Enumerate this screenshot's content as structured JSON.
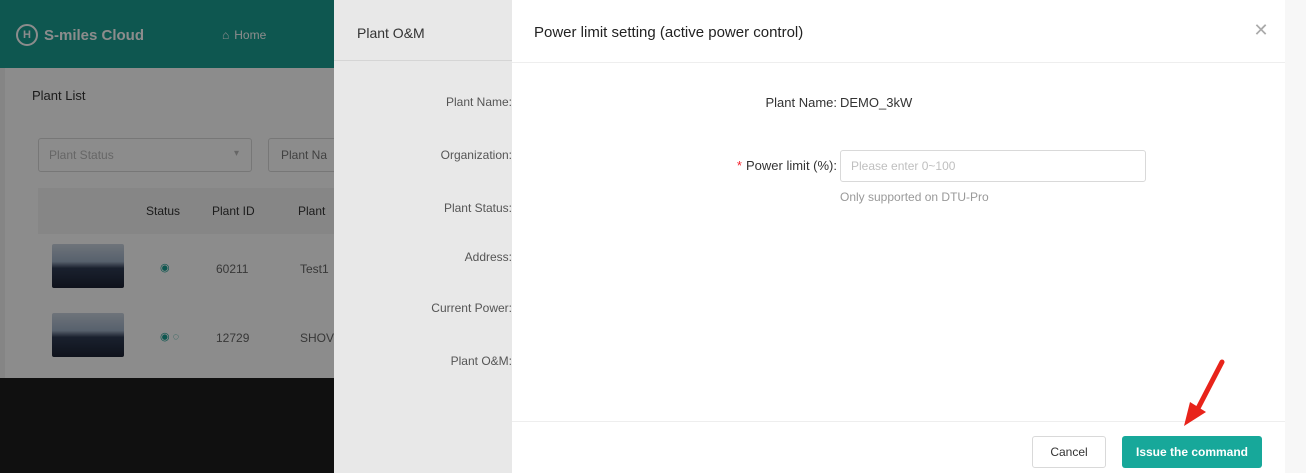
{
  "app": {
    "brand": "S-miles Cloud",
    "logo_glyph": "H",
    "nav_home": "Home",
    "accent_color": "#1a9e92"
  },
  "plant_list": {
    "title": "Plant List",
    "status_placeholder": "Plant Status",
    "plant_name_placeholder": "Plant Na",
    "columns": [
      "Status",
      "Plant ID",
      "Plant"
    ],
    "rows": [
      {
        "plant_id": "60211",
        "plant_name": "Test1"
      },
      {
        "plant_id": "12729",
        "plant_name": "SHOV"
      }
    ]
  },
  "om_drawer": {
    "title": "Plant O&M",
    "fields": [
      "Plant Name:",
      "Organization:",
      "Plant Status:",
      "Address:",
      "Current Power:",
      "Plant O&M:"
    ]
  },
  "modal": {
    "title": "Power limit setting (active power control)",
    "plant_name_label": "Plant Name:",
    "plant_name_value": "DEMO_3kW",
    "required_mark": "*",
    "power_limit_label": "Power limit (%):",
    "power_limit_placeholder": "Please enter 0~100",
    "power_limit_value": "",
    "hint": "Only supported on DTU-Pro",
    "cancel_label": "Cancel",
    "issue_label": "Issue the command",
    "close_icon": "close-icon"
  }
}
